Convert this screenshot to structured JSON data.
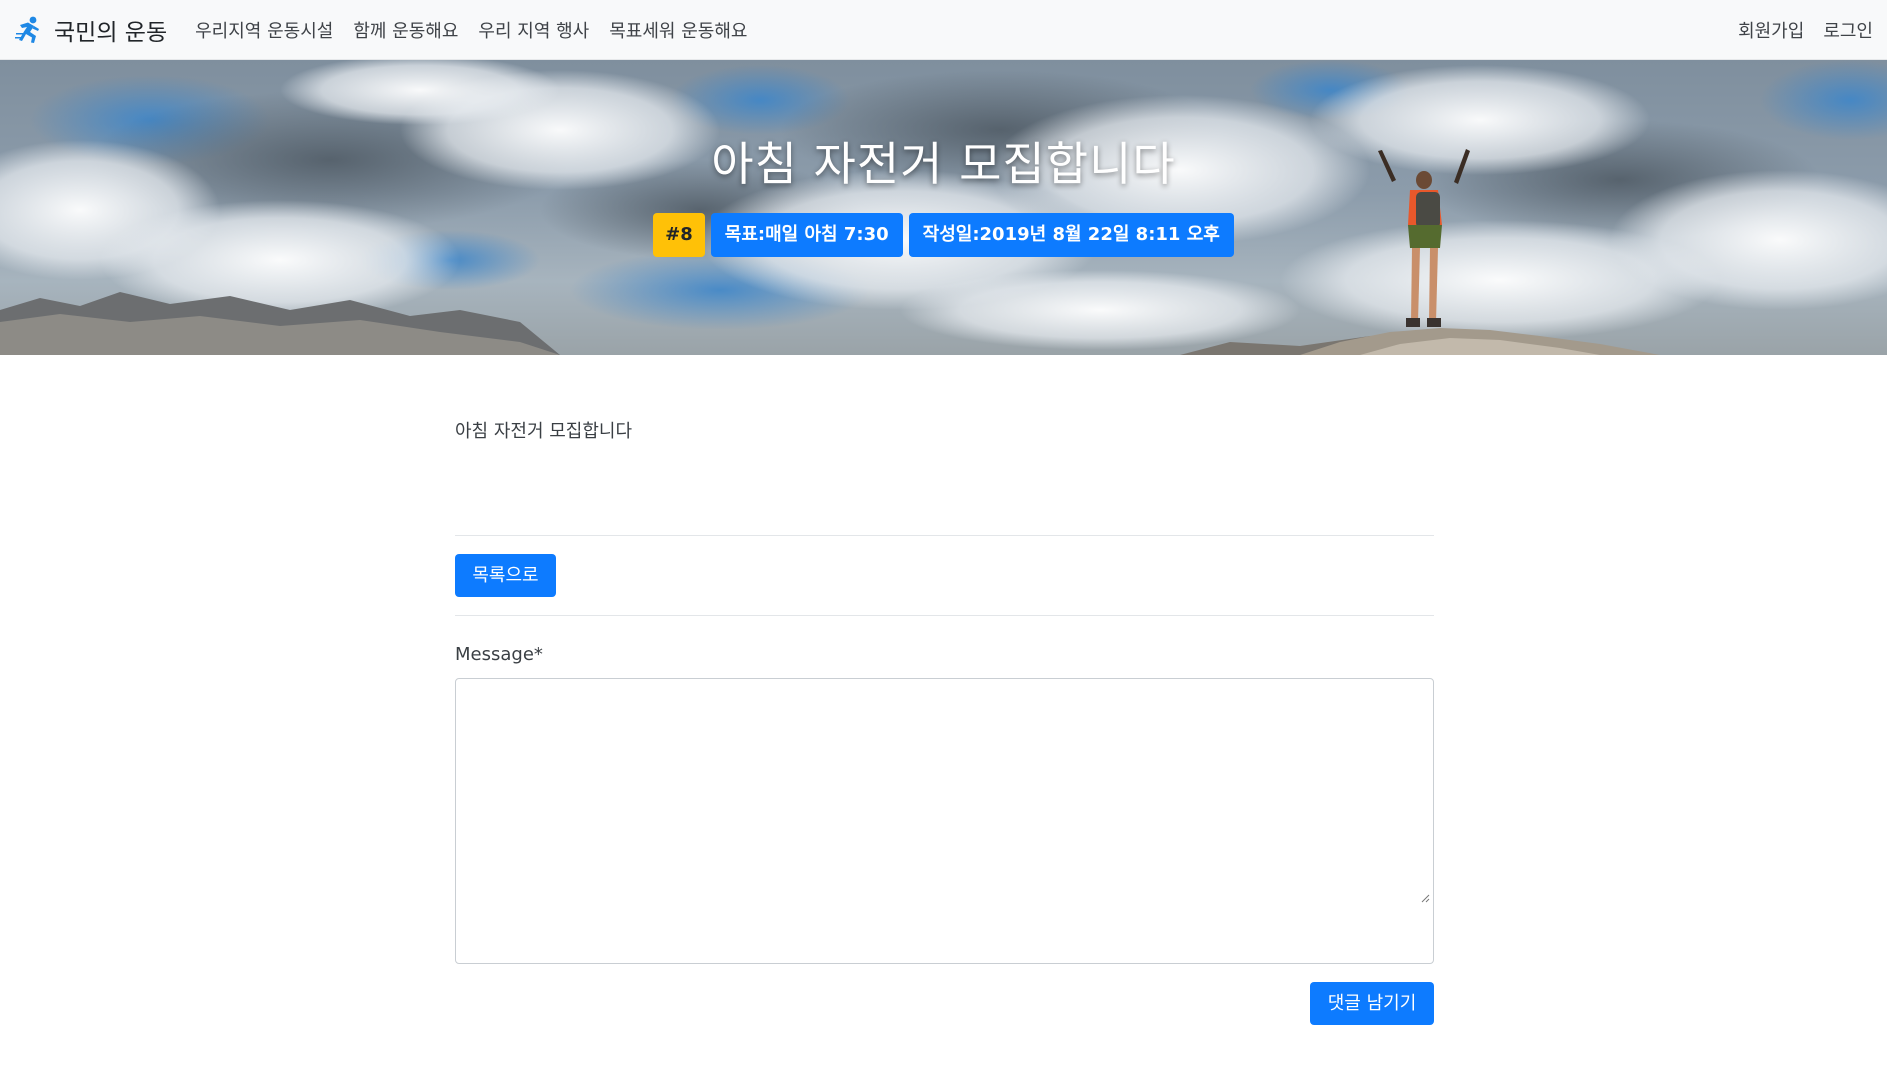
{
  "navbar": {
    "brand": "국민의 운동",
    "links": [
      "우리지역 운동시설",
      "함께 운동해요",
      "우리 지역 행사",
      "목표세워 운동해요"
    ],
    "right_links": [
      "회원가입",
      "로그인"
    ]
  },
  "hero": {
    "title": "아침 자전거 모집합니다",
    "badges": {
      "number": "#8",
      "goal": "목표:매일 아침 7:30",
      "date": "작성일:2019년 8월 22일 8:11 오후"
    }
  },
  "post": {
    "body": "아침 자전거 모집합니다"
  },
  "actions": {
    "list_button": "목록으로"
  },
  "comment_form": {
    "label": "Message*",
    "message_value": "",
    "submit_button": "댓글 남기기"
  },
  "colors": {
    "primary": "#0d7bff",
    "warning": "#ffc107",
    "navbar_bg": "#f8f9fa",
    "logo": "#1e88e5"
  },
  "icons": {
    "brand_logo": "running-person-icon",
    "resize": "resize-grip-icon"
  }
}
